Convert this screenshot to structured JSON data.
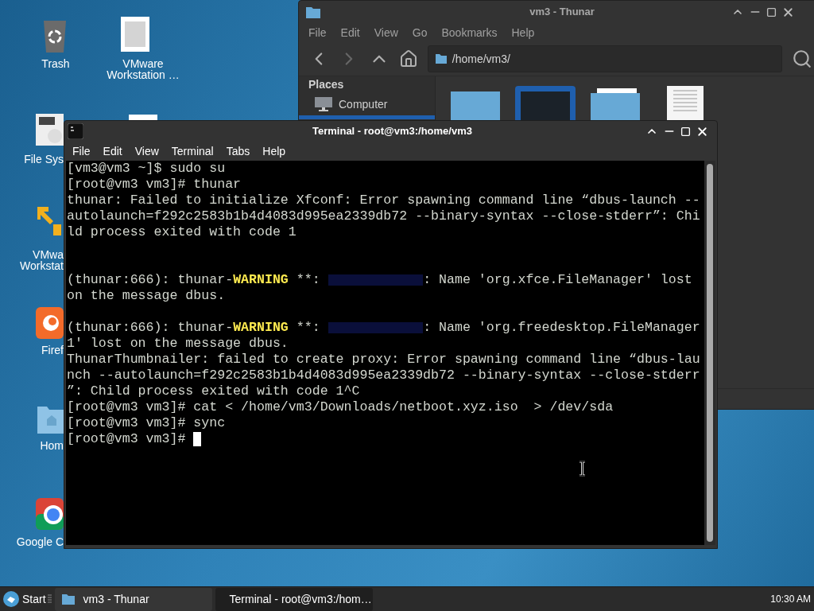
{
  "desktop_icons": [
    {
      "kind": "trash",
      "lines": [
        "Trash"
      ]
    },
    {
      "kind": "vmware-doc",
      "lines": [
        "VMware",
        "Workstation …"
      ]
    },
    {
      "kind": "disk",
      "lines": [
        "File Sys"
      ]
    },
    {
      "kind": "doc-top"
    },
    {
      "kind": "vmware",
      "lines": [
        "VMwa",
        "Workstat"
      ]
    },
    {
      "kind": "firefox",
      "lines": [
        "Firef"
      ]
    },
    {
      "kind": "home",
      "lines": [
        "Hom"
      ]
    },
    {
      "kind": "chrome",
      "lines": [
        "Google C"
      ]
    }
  ],
  "thunar": {
    "title": "vm3 - Thunar",
    "menu": [
      "File",
      "Edit",
      "View",
      "Go",
      "Bookmarks",
      "Help"
    ],
    "path": "/home/vm3/",
    "sidebar_heading": "Places",
    "places": [
      {
        "label": "Computer",
        "selected": false
      },
      {
        "selected": true
      }
    ],
    "files": [
      {
        "kind": "folder",
        "selected": false
      },
      {
        "kind": "folder",
        "selected": true
      },
      {
        "kind": "folder-open",
        "selected": false
      },
      {
        "kind": "document",
        "selected": false
      }
    ]
  },
  "terminal": {
    "title": "Terminal - root@vm3:/home/vm3",
    "menu": [
      "File",
      "Edit",
      "View",
      "Terminal",
      "Tabs",
      "Help"
    ],
    "rows": [
      {
        "segments": [
          {
            "kind": "plain",
            "text": "[vm3@vm3 ~]$ sudo su"
          }
        ]
      },
      {
        "segments": [
          {
            "kind": "plain",
            "text": "[root@vm3 vm3]# thunar"
          }
        ]
      },
      {
        "segments": [
          {
            "kind": "plain",
            "text": "thunar: Failed to initialize Xfconf: Error spawning command line “dbus-launch --"
          }
        ]
      },
      {
        "segments": [
          {
            "kind": "plain",
            "text": "autolaunch=f292c2583b1b4d4083d995ea2339db72 --binary-syntax --close-stderr”: Chi"
          }
        ]
      },
      {
        "segments": [
          {
            "kind": "plain",
            "text": "ld process exited with code 1"
          }
        ]
      },
      {
        "segments": [
          {
            "kind": "blank"
          }
        ]
      },
      {
        "segments": [
          {
            "kind": "blank"
          }
        ]
      },
      {
        "segments": [
          {
            "kind": "plain",
            "text": "(thunar:666): thunar-"
          },
          {
            "kind": "warning",
            "text": "WARNING"
          },
          {
            "kind": "plain",
            "text": " **: "
          },
          {
            "kind": "redacted"
          },
          {
            "kind": "plain",
            "text": ": Name 'org.xfce.FileManager' lost"
          }
        ]
      },
      {
        "segments": [
          {
            "kind": "plain",
            "text": "on the message dbus."
          }
        ]
      },
      {
        "segments": [
          {
            "kind": "blank"
          }
        ]
      },
      {
        "segments": [
          {
            "kind": "plain",
            "text": "(thunar:666): thunar-"
          },
          {
            "kind": "warning",
            "text": "WARNING"
          },
          {
            "kind": "plain",
            "text": " **: "
          },
          {
            "kind": "redacted"
          },
          {
            "kind": "plain",
            "text": ": Name 'org.freedesktop.FileManager"
          }
        ]
      },
      {
        "segments": [
          {
            "kind": "plain",
            "text": "1' lost on the message dbus."
          }
        ]
      },
      {
        "segments": [
          {
            "kind": "plain",
            "text": "ThunarThumbnailer: failed to create proxy: Error spawning command line “dbus-lau"
          }
        ]
      },
      {
        "segments": [
          {
            "kind": "plain",
            "text": "nch --autolaunch=f292c2583b1b4d4083d995ea2339db72 --binary-syntax --close-stderr"
          }
        ]
      },
      {
        "segments": [
          {
            "kind": "plain",
            "text": "”: Child process exited with code 1^C"
          }
        ]
      },
      {
        "segments": [
          {
            "kind": "plain",
            "text": "[root@vm3 vm3]# cat < /home/vm3/Downloads/netboot.xyz.iso  > /dev/sda"
          }
        ]
      },
      {
        "segments": [
          {
            "kind": "plain",
            "text": "[root@vm3 vm3]# sync"
          }
        ]
      },
      {
        "segments": [
          {
            "kind": "plain",
            "text": "[root@vm3 vm3]# "
          },
          {
            "kind": "cursor"
          }
        ]
      }
    ]
  },
  "taskbar": {
    "start": "Start",
    "tasks": [
      {
        "kind": "thunar",
        "label": "vm3 - Thunar",
        "selected": false
      },
      {
        "kind": "terminal",
        "label": "Terminal - root@vm3:/hom…",
        "selected": true
      }
    ],
    "clock": "10:30 AM"
  }
}
